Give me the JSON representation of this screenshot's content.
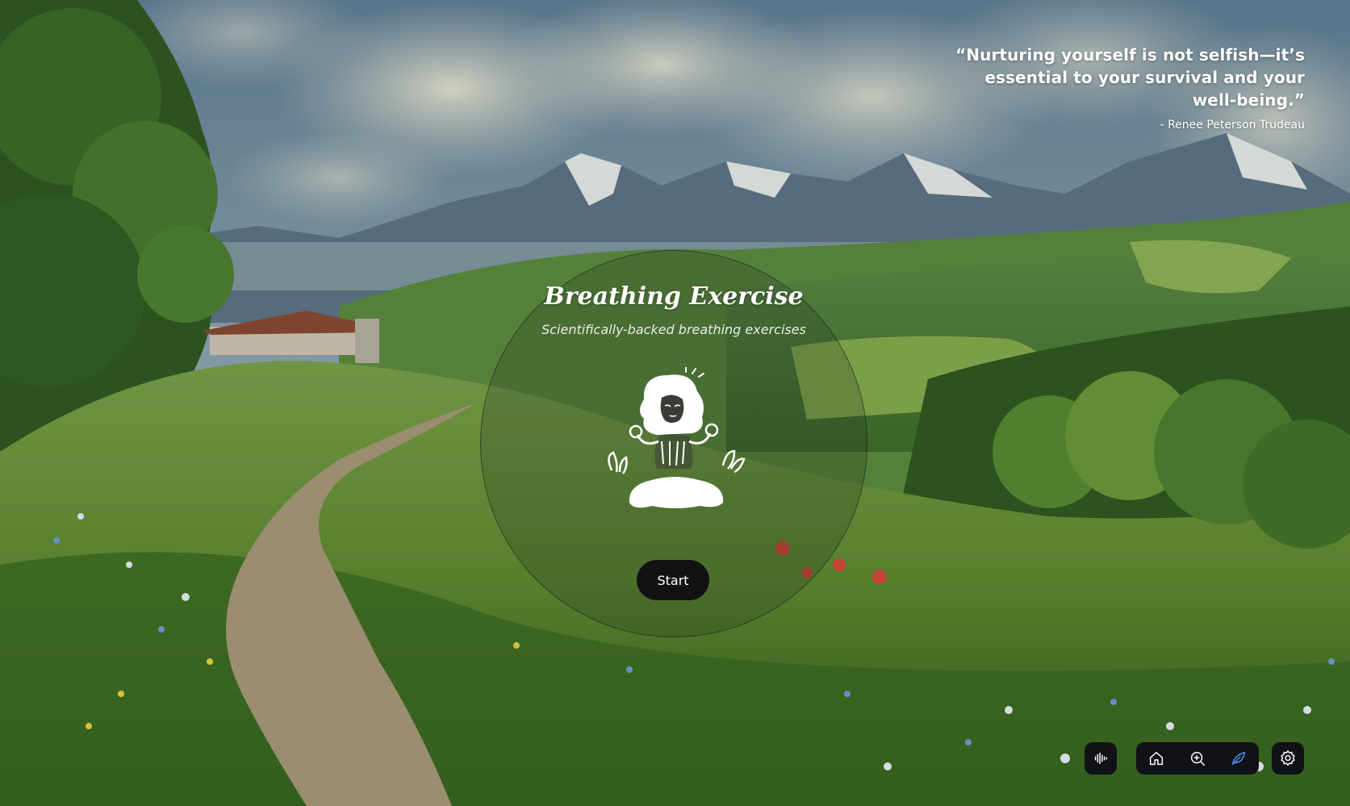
{
  "quote": {
    "text": "“Nurturing yourself is not selfish—it’s essential to your survival and your well-being.”",
    "author": "- Renee Peterson Trudeau"
  },
  "exercise": {
    "title": "Breathing Exercise",
    "subtitle": "Scientifically-backed breathing exercises",
    "start_label": "Start"
  },
  "toolbar": {
    "items": [
      {
        "icon": "sound-wave-icon"
      },
      {
        "icon": "home-icon"
      },
      {
        "icon": "search-zoom-icon"
      },
      {
        "icon": "leaf-icon",
        "active": true
      },
      {
        "icon": "gear-icon"
      }
    ]
  },
  "colors": {
    "accent": "#4a86d8",
    "button_bg": "#121214",
    "toolbar_bg": "#111216"
  }
}
